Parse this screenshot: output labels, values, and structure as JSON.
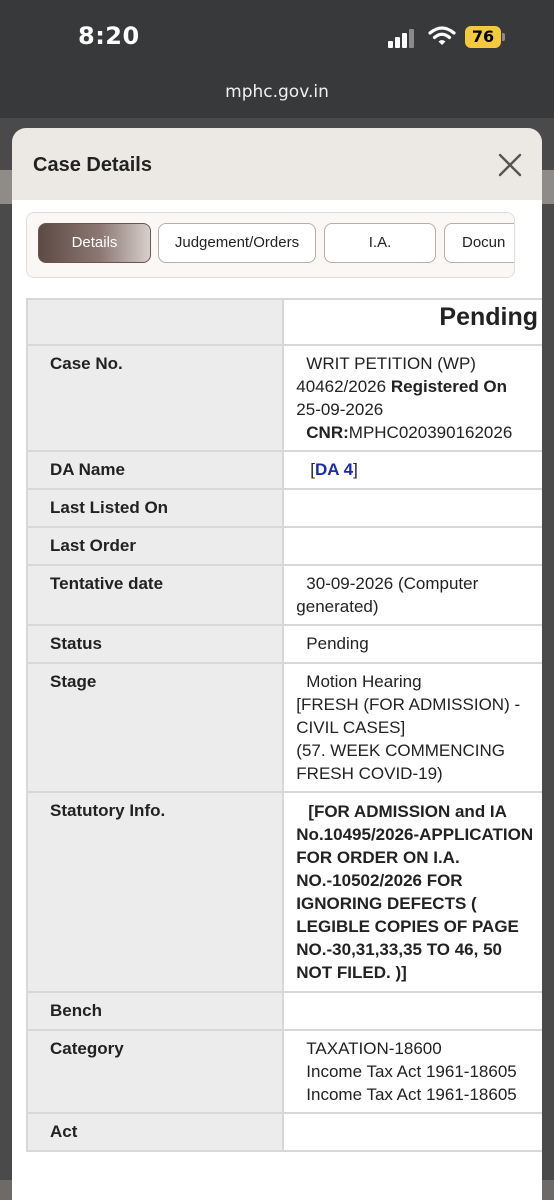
{
  "status_bar": {
    "time": "8:20",
    "battery": "76",
    "url": "mphc.gov.in"
  },
  "modal": {
    "title": "Case Details",
    "tabs": [
      "Details",
      "Judgement/Orders",
      "I.A.",
      "Docun"
    ],
    "active_tab": "Details"
  },
  "details": {
    "header_status": "Pending",
    "rows": {
      "case_no": {
        "label": "Case No.",
        "line1": "WRIT PETITION (WP)",
        "number": "40462/2026",
        "registered_label": "Registered On",
        "registered_date": "25-09-2026",
        "cnr_label": "CNR:",
        "cnr_value": "MPHC020390162026"
      },
      "da_name": {
        "label": "DA Name",
        "open": "[",
        "value": "DA 4",
        "close": "]"
      },
      "last_listed_on": {
        "label": "Last Listed On",
        "value": ""
      },
      "last_order": {
        "label": "Last Order",
        "value": ""
      },
      "tentative_date": {
        "label": "Tentative date",
        "value": "30-09-2026 (Computer generated)"
      },
      "status": {
        "label": "Status",
        "value": "Pending"
      },
      "stage": {
        "label": "Stage",
        "line1": "Motion Hearing",
        "line2": "[FRESH (FOR ADMISSION) - CIVIL CASES]",
        "line3": "(57. WEEK COMMENCING FRESH COVID-19)"
      },
      "statutory_info": {
        "label": "Statutory Info.",
        "value": "[FOR ADMISSION and IA No.10495/2026-APPLICATION FOR ORDER ON I.A. NO.-10502/2026 FOR IGNORING DEFECTS ( LEGIBLE COPIES OF PAGE NO.-30,31,33,35 TO 46, 50 NOT FILED. )]"
      },
      "bench": {
        "label": "Bench",
        "value": ""
      },
      "category": {
        "label": "Category",
        "line1": "TAXATION-18600",
        "line2": "Income Tax Act 1961-18605",
        "line3": "Income Tax Act 1961-18605"
      },
      "act": {
        "label": "Act",
        "value": ""
      }
    }
  },
  "colors": {
    "pending_header": "#b9b9ec",
    "link_blue": "#1b2ca8",
    "status_red": "#d21d1d",
    "statutory_green": "#148514"
  }
}
